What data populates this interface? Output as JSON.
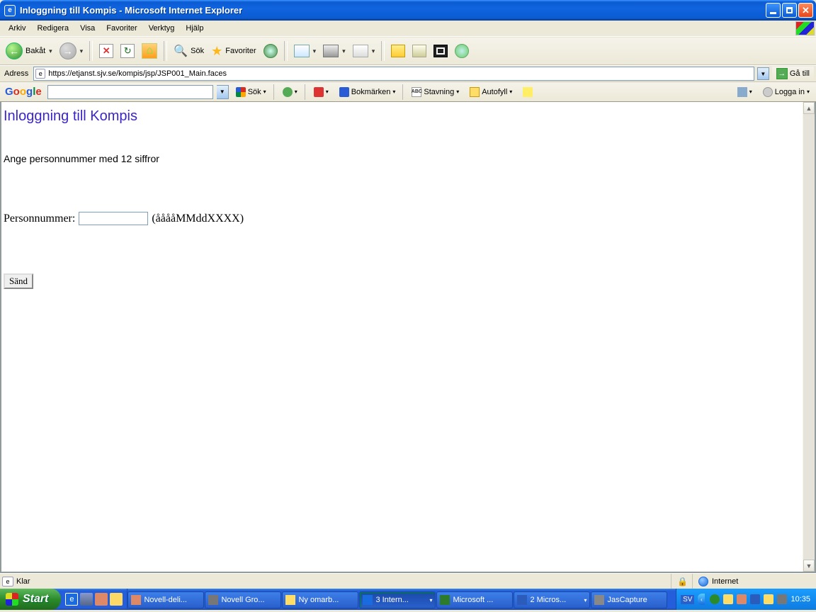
{
  "window": {
    "title": "Inloggning till Kompis - Microsoft Internet Explorer"
  },
  "menu": {
    "arkiv": "Arkiv",
    "redigera": "Redigera",
    "visa": "Visa",
    "favoriter": "Favoriter",
    "verktyg": "Verktyg",
    "hjalp": "Hjälp"
  },
  "toolbar": {
    "back": "Bakåt",
    "search": "Sök",
    "favorites": "Favoriter"
  },
  "address": {
    "label": "Adress",
    "url": "https://etjanst.sjv.se/kompis/jsp/JSP001_Main.faces",
    "go": "Gå till"
  },
  "google": {
    "sok": "Sök",
    "bokmarken": "Bokmärken",
    "stavning": "Stavning",
    "autofyll": "Autofyll",
    "loggain": "Logga in",
    "abc": "ABC"
  },
  "page": {
    "heading": "Inloggning till Kompis",
    "instruction": "Ange personnummer med 12 siffror",
    "field_label": "Personnummer:",
    "field_hint": "(ååååMMddXXXX)",
    "submit": "Sänd"
  },
  "status": {
    "ready": "Klar",
    "zone": "Internet"
  },
  "taskbar": {
    "start": "Start",
    "t1": "Novell-deli...",
    "t2": "Novell Gro...",
    "t3": "Ny omarb...",
    "t4": "3 Intern...",
    "t5": "Microsoft ...",
    "t6": "2 Micros...",
    "t7": "JasCapture",
    "lang": "SV",
    "clock": "10:35"
  }
}
